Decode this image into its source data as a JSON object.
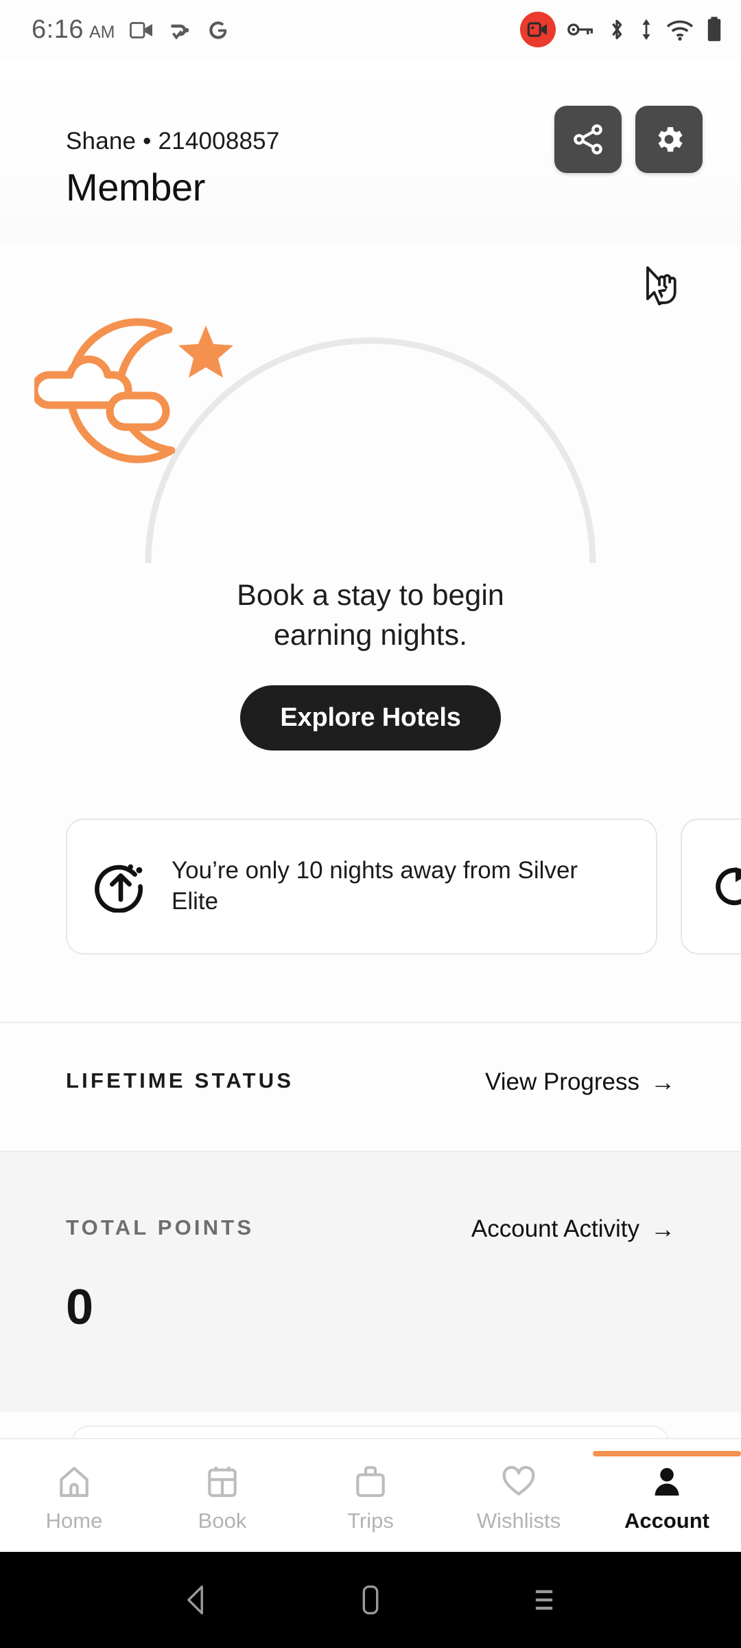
{
  "status_bar": {
    "time": "6:16",
    "meridiem": "AM",
    "left_icons": [
      "video-camera-icon",
      "vpn-key-check-icon",
      "google-g-icon"
    ],
    "right_icons": [
      "screen-record-icon",
      "key-icon",
      "bluetooth-icon",
      "data-transfer-icon",
      "wifi-icon",
      "battery-icon"
    ],
    "recording_badge_color": "#EA3B2E"
  },
  "header": {
    "subtitle": "Shane • 214008857",
    "title": "Member",
    "share_label": "Share",
    "settings_label": "Settings"
  },
  "hero": {
    "illustration": "moon-cloud-star-icon",
    "progress_percent": 0,
    "message_line1": "Book a stay to begin",
    "message_line2": "earning nights.",
    "cta_label": "Explore Hotels",
    "accent_color": "#F5914E"
  },
  "promos": [
    {
      "icon": "arrow-up-progress-icon",
      "text": "You’re only 10 nights away from Silver Elite"
    },
    {
      "icon": "refresh-rotate-icon",
      "text": ""
    }
  ],
  "lifetime_status": {
    "label": "LIFETIME STATUS",
    "link_label": "View Progress",
    "link_arrow": "→"
  },
  "total_points": {
    "label": "TOTAL POINTS",
    "link_label": "Account Activity",
    "link_arrow": "→",
    "value": "0"
  },
  "bottom_nav": {
    "items": [
      {
        "label": "Home",
        "icon": "home-icon",
        "active": false
      },
      {
        "label": "Book",
        "icon": "calendar-icon",
        "active": false
      },
      {
        "label": "Trips",
        "icon": "briefcase-icon",
        "active": false
      },
      {
        "label": "Wishlists",
        "icon": "heart-icon",
        "active": false
      },
      {
        "label": "Account",
        "icon": "person-icon",
        "active": true
      }
    ],
    "active_indicator_color": "#F5914E"
  },
  "android_nav": {
    "back_label": "Back",
    "home_label": "Home",
    "recents_label": "Recents"
  }
}
